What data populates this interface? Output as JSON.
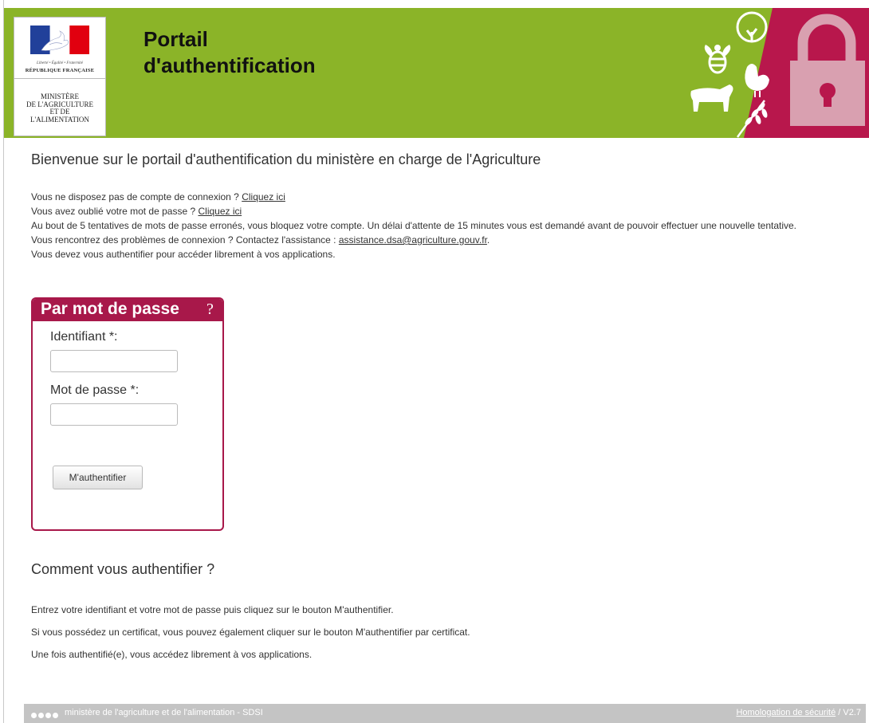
{
  "header": {
    "logo": {
      "motto": "Liberté • Égalité • Fraternité",
      "republic": "RÉPUBLIQUE FRANÇAISE",
      "ministry_lines": [
        "MINISTÈRE",
        "DE L'AGRICULTURE",
        "ET DE",
        "L'ALIMENTATION"
      ]
    },
    "title_lines": [
      "Portail",
      "d'authentification"
    ],
    "colors": {
      "green": "#8bb428",
      "crimson": "#b8174c"
    },
    "icons": [
      "bee-icon",
      "tree-icon",
      "hen-icon",
      "cow-icon",
      "wheat-icon",
      "padlock-icon"
    ]
  },
  "welcome": "Bienvenue sur le portail d'authentification du ministère en charge de l'Agriculture",
  "info": {
    "no_account": "Vous ne disposez pas de compte de connexion ?",
    "no_account_link": "Cliquez ici",
    "forgot": "Vous avez oublié votre mot de passe ?",
    "forgot_link": "Cliquez ici",
    "lockout": "Au bout de 5 tentatives de mots de passe erronés, vous bloquez votre compte. Un délai d'attente de 15 minutes vous est demandé avant de pouvoir effectuer une nouvelle tentative.",
    "support": "Vous rencontrez des problèmes de connexion ? Contactez l'assistance :",
    "support_email": "assistance.dsa@agriculture.gouv.fr",
    "support_end": ".",
    "must_auth": "Vous devez vous authentifier pour accéder librement à vos applications."
  },
  "login": {
    "title": "Par mot de passe",
    "help": "?",
    "id_label": "Identifiant *:",
    "id_value": "",
    "pw_label": "Mot de passe *:",
    "pw_value": "",
    "submit": "M'authentifier",
    "color": "#a8184a"
  },
  "howto": {
    "title": "Comment vous authentifier ?",
    "lines": [
      "Entrez votre identifiant et votre mot de passe puis cliquez sur le bouton M'authentifier.",
      "Si vous possédez un certificat, vous pouvez également cliquer sur le bouton M'authentifier par certificat.",
      "Une fois authentifié(e), vous accédez librement à vos applications."
    ]
  },
  "footer": {
    "text": "ministère de l'agriculture et de l'alimentation - SDSI",
    "link": "Homologation de sécurité",
    "version": " / V2.7"
  }
}
